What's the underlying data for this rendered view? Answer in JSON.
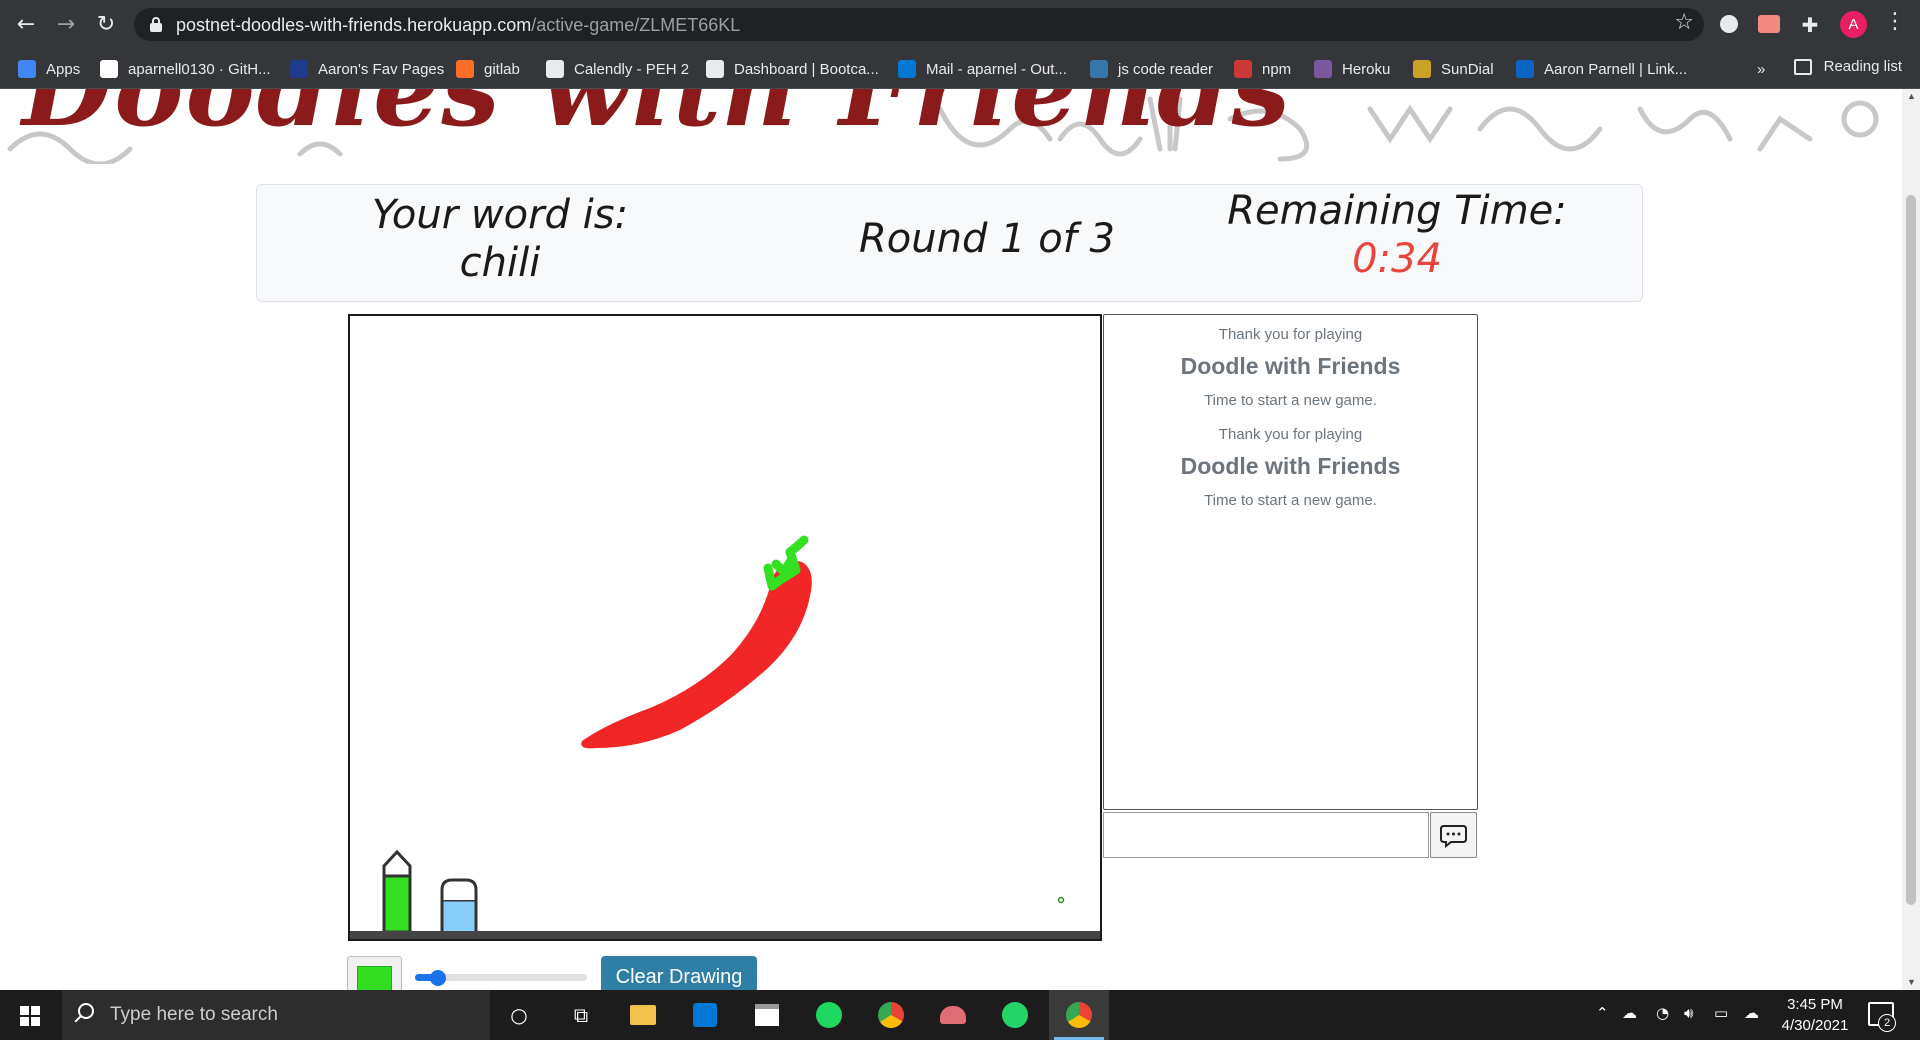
{
  "browser": {
    "url_domain": "postnet-doodles-with-friends.herokuapp.com",
    "url_path": "/active-game/ZLMET66KL",
    "profile_initial": "A",
    "bookmarks": [
      {
        "label": "Apps",
        "color": "#4285f4"
      },
      {
        "label": "aparnell0130 · GitH...",
        "color": "#ffffff"
      },
      {
        "label": "Aaron's Fav Pages",
        "color": "#1e3a8a"
      },
      {
        "label": "gitlab",
        "color": "#fc6d26"
      },
      {
        "label": "Calendly - PEH 2",
        "color": "#e8eaed"
      },
      {
        "label": "Dashboard | Bootca...",
        "color": "#e8eaed"
      },
      {
        "label": "Mail - aparnel - Out...",
        "color": "#0078d4"
      },
      {
        "label": "js code reader",
        "color": "#3776ab"
      },
      {
        "label": "npm",
        "color": "#cb3837"
      },
      {
        "label": "Heroku",
        "color": "#79589f"
      },
      {
        "label": "SunDial",
        "color": "#c9a227"
      },
      {
        "label": "Aaron Parnell | Link...",
        "color": "#0a66c2"
      }
    ],
    "more_bookmarks": "»",
    "reading_list": "Reading list"
  },
  "game": {
    "site_title": "Doodles with Friends",
    "word_label": "Your word is:",
    "word": "chili",
    "round": "Round 1 of 3",
    "time_label": "Remaining Time:",
    "time_value": "0:34",
    "brush_color": "#33dd22",
    "brush_size_fraction": 0.09,
    "clear_label": "Clear Drawing"
  },
  "chat": {
    "messages": [
      {
        "line1": "Thank you for playing",
        "line2": "Doodle with Friends",
        "line3": "Time to start a new game."
      },
      {
        "line1": "Thank you for playing",
        "line2": "Doodle with Friends",
        "line3": "Time to start a new game."
      }
    ],
    "input_value": "",
    "send_icon": "chat-bubble-icon"
  },
  "taskbar": {
    "search_placeholder": "Type here to search",
    "time": "3:45 PM",
    "date": "4/30/2021",
    "notification_count": "2"
  }
}
